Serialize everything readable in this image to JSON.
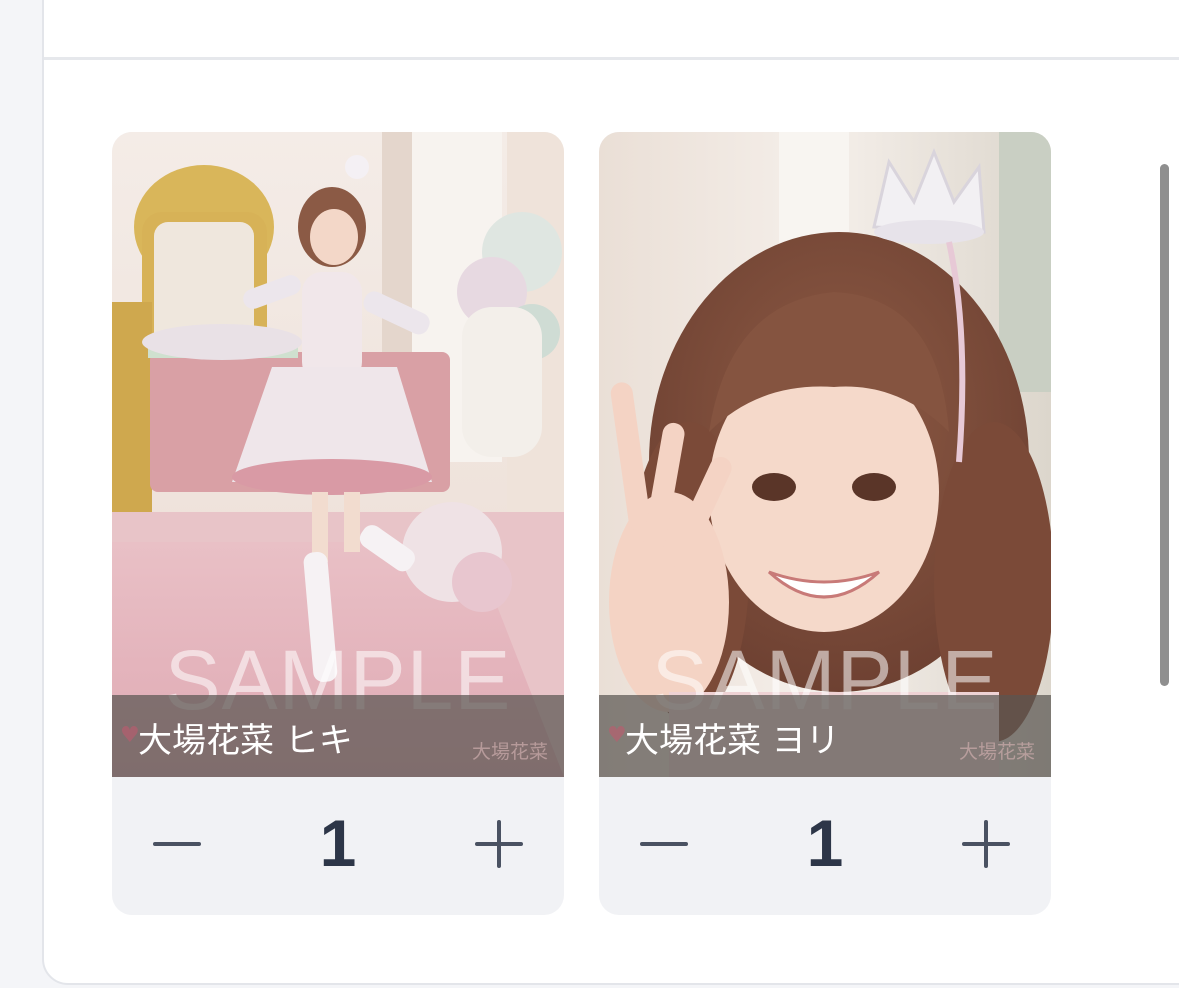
{
  "cards": [
    {
      "name": "大場花菜 ヒキ",
      "watermark": "SAMPLE",
      "logo_text": "大場花菜",
      "quantity": "1",
      "minus_label": "−",
      "plus_label": "+"
    },
    {
      "name": "大場花菜 ヨリ",
      "watermark": "SAMPLE",
      "logo_text": "大場花菜",
      "quantity": "1",
      "minus_label": "−",
      "plus_label": "+"
    }
  ],
  "colors": {
    "card_bg": "#f1f2f5",
    "quantity_text": "#2d3648",
    "stepper_icon": "#4a5262",
    "name_bar": "#5a5652"
  },
  "icons": {
    "minus": "minus-icon",
    "plus": "plus-icon",
    "watermark_heart": "heart-icon"
  }
}
